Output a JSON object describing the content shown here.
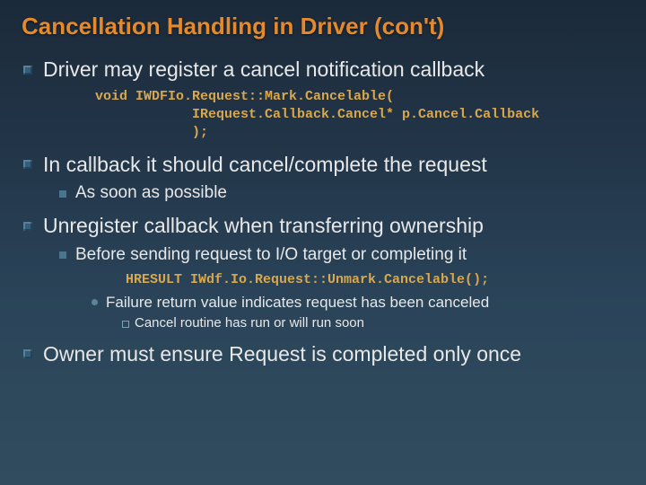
{
  "title": "Cancellation Handling in Driver (con't)",
  "bullets": [
    {
      "text": "Driver may register a cancel notification callback",
      "code": "void IWDFIo.Request::Mark.Cancelable(\n            IRequest.Callback.Cancel* p.Cancel.Callback\n            );"
    },
    {
      "text": "In callback it should cancel/complete the request",
      "children": [
        {
          "text": "As soon as possible"
        }
      ]
    },
    {
      "text": "Unregister callback when transferring ownership",
      "children": [
        {
          "text": "Before sending request to I/O target or completing it",
          "code": "HRESULT IWdf.Io.Request::Unmark.Cancelable();",
          "children": [
            {
              "text": "Failure return value indicates request has been canceled",
              "children": [
                {
                  "text": "Cancel routine has run or will run soon"
                }
              ]
            }
          ]
        }
      ]
    },
    {
      "text": "Owner must ensure Request is completed only once"
    }
  ]
}
